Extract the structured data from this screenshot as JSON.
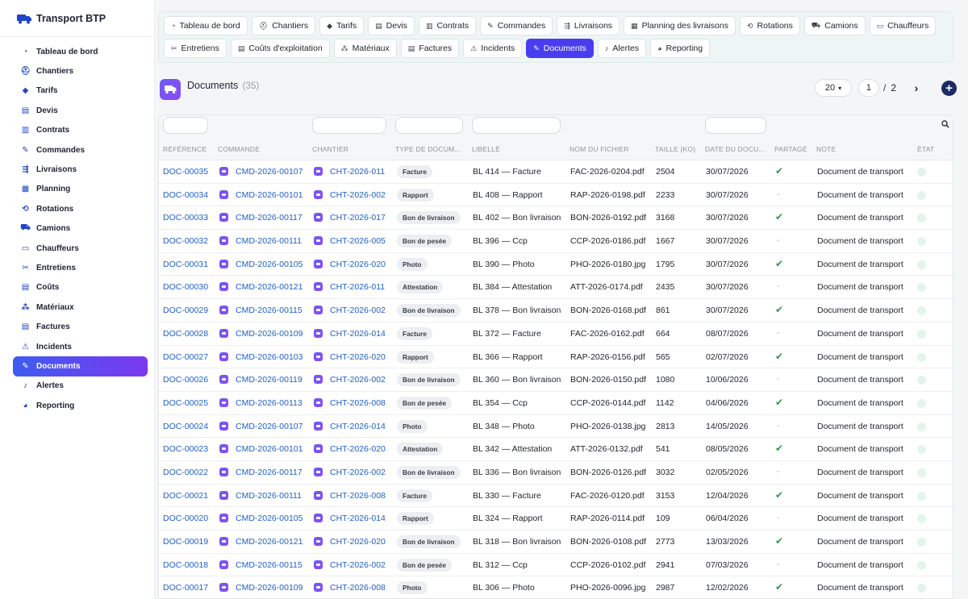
{
  "app": {
    "title": "Transport BTP"
  },
  "sidebar": {
    "items": [
      {
        "label": "Tableau de bord",
        "icon": "dashboard-icon"
      },
      {
        "label": "Chantiers",
        "icon": "helmet-icon"
      },
      {
        "label": "Tarifs",
        "icon": "tag-icon"
      },
      {
        "label": "Devis",
        "icon": "document-icon"
      },
      {
        "label": "Contrats",
        "icon": "contract-icon"
      },
      {
        "label": "Commandes",
        "icon": "order-icon"
      },
      {
        "label": "Livraisons",
        "icon": "delivery-icon"
      },
      {
        "label": "Planning",
        "icon": "calendar-icon"
      },
      {
        "label": "Rotations",
        "icon": "route-icon"
      },
      {
        "label": "Camions",
        "icon": "truck-icon"
      },
      {
        "label": "Chauffeurs",
        "icon": "id-card-icon"
      },
      {
        "label": "Entretiens",
        "icon": "tools-icon"
      },
      {
        "label": "Coûts",
        "icon": "coins-icon"
      },
      {
        "label": "Matériaux",
        "icon": "materials-icon"
      },
      {
        "label": "Factures",
        "icon": "invoice-icon"
      },
      {
        "label": "Incidents",
        "icon": "warning-icon"
      },
      {
        "label": "Documents",
        "icon": "paperclip-icon",
        "active": true
      },
      {
        "label": "Alertes",
        "icon": "bell-icon"
      },
      {
        "label": "Reporting",
        "icon": "pie-chart-icon"
      }
    ]
  },
  "tabs": {
    "row1": [
      {
        "label": "Tableau de bord",
        "icon": "dashboard-icon",
        "glyph": "◔"
      },
      {
        "label": "Chantiers",
        "icon": "helmet-icon",
        "glyph": "⛑"
      },
      {
        "label": "Tarifs",
        "icon": "tag-icon",
        "glyph": "◆"
      },
      {
        "label": "Devis",
        "icon": "document-icon",
        "glyph": "▤"
      },
      {
        "label": "Contrats",
        "icon": "contract-icon",
        "glyph": "▥"
      },
      {
        "label": "Commandes",
        "icon": "order-icon",
        "glyph": "✎"
      },
      {
        "label": "Livraisons",
        "icon": "delivery-icon",
        "glyph": "⇶"
      },
      {
        "label": "Planning des livraisons",
        "icon": "calendar-icon",
        "glyph": "▦"
      },
      {
        "label": "Rotations",
        "icon": "route-icon",
        "glyph": "⟲"
      },
      {
        "label": "Camions",
        "icon": "truck-icon",
        "glyph": "⛟"
      },
      {
        "label": "Chauffeurs",
        "icon": "id-card-icon",
        "glyph": "▭"
      }
    ],
    "row2": [
      {
        "label": "Entretiens",
        "icon": "tools-icon",
        "glyph": "✂"
      },
      {
        "label": "Coûts d'exploitation",
        "icon": "coins-icon",
        "glyph": "▤"
      },
      {
        "label": "Matériaux",
        "icon": "materials-icon",
        "glyph": "⁂"
      },
      {
        "label": "Factures",
        "icon": "invoice-icon",
        "glyph": "▤"
      },
      {
        "label": "Incidents",
        "icon": "warning-icon",
        "glyph": "⚠"
      },
      {
        "label": "Documents",
        "icon": "paperclip-icon",
        "glyph": "✎",
        "active": true
      },
      {
        "label": "Alertes",
        "icon": "bell-icon",
        "glyph": "♪"
      },
      {
        "label": "Reporting",
        "icon": "pie-chart-icon",
        "glyph": "◕"
      }
    ]
  },
  "page": {
    "title": "Documents",
    "count": "(35)"
  },
  "pager": {
    "page_size": "20",
    "current_page": "1",
    "separator": "/",
    "total_pages": "2"
  },
  "columns": [
    "Référence",
    "Commande",
    "Chantier",
    "Type de docum...",
    "Libellé",
    "Nom du fichier",
    "Taille (Ko)",
    "Date du docu...",
    "Partagé",
    "Note",
    "État"
  ],
  "rows": [
    {
      "ref": "DOC-00035",
      "cmd": "CMD-2026-00107",
      "cht": "CHT-2026-011",
      "type": "Facture",
      "lib": "BL 414 — Facture",
      "file": "FAC-2026-0204.pdf",
      "size": "2504",
      "date": "30/07/2026",
      "shared": true,
      "note": "Document de transport"
    },
    {
      "ref": "DOC-00034",
      "cmd": "CMD-2026-00101",
      "cht": "CHT-2026-002",
      "type": "Rapport",
      "lib": "BL 408 — Rapport",
      "file": "RAP-2026-0198.pdf",
      "size": "2233",
      "date": "30/07/2026",
      "shared": false,
      "note": "Document de transport"
    },
    {
      "ref": "DOC-00033",
      "cmd": "CMD-2026-00117",
      "cht": "CHT-2026-017",
      "type": "Bon de livraison",
      "lib": "BL 402 — Bon livraison",
      "file": "BON-2026-0192.pdf",
      "size": "3168",
      "date": "30/07/2026",
      "shared": true,
      "note": "Document de transport"
    },
    {
      "ref": "DOC-00032",
      "cmd": "CMD-2026-00111",
      "cht": "CHT-2026-005",
      "type": "Bon de pesée",
      "lib": "BL 396 — Ccp",
      "file": "CCP-2026-0186.pdf",
      "size": "1667",
      "date": "30/07/2026",
      "shared": false,
      "note": "Document de transport"
    },
    {
      "ref": "DOC-00031",
      "cmd": "CMD-2026-00105",
      "cht": "CHT-2026-020",
      "type": "Photo",
      "lib": "BL 390 — Photo",
      "file": "PHO-2026-0180.jpg",
      "size": "1795",
      "date": "30/07/2026",
      "shared": true,
      "note": "Document de transport"
    },
    {
      "ref": "DOC-00030",
      "cmd": "CMD-2026-00121",
      "cht": "CHT-2026-011",
      "type": "Attestation",
      "lib": "BL 384 — Attestation",
      "file": "ATT-2026-0174.pdf",
      "size": "2435",
      "date": "30/07/2026",
      "shared": false,
      "note": "Document de transport"
    },
    {
      "ref": "DOC-00029",
      "cmd": "CMD-2026-00115",
      "cht": "CHT-2026-002",
      "type": "Bon de livraison",
      "lib": "BL 378 — Bon livraison",
      "file": "BON-2026-0168.pdf",
      "size": "861",
      "date": "30/07/2026",
      "shared": true,
      "note": "Document de transport"
    },
    {
      "ref": "DOC-00028",
      "cmd": "CMD-2026-00109",
      "cht": "CHT-2026-014",
      "type": "Facture",
      "lib": "BL 372 — Facture",
      "file": "FAC-2026-0162.pdf",
      "size": "664",
      "date": "08/07/2026",
      "shared": false,
      "note": "Document de transport"
    },
    {
      "ref": "DOC-00027",
      "cmd": "CMD-2026-00103",
      "cht": "CHT-2026-020",
      "type": "Rapport",
      "lib": "BL 366 — Rapport",
      "file": "RAP-2026-0156.pdf",
      "size": "565",
      "date": "02/07/2026",
      "shared": true,
      "note": "Document de transport"
    },
    {
      "ref": "DOC-00026",
      "cmd": "CMD-2026-00119",
      "cht": "CHT-2026-002",
      "type": "Bon de livraison",
      "lib": "BL 360 — Bon livraison",
      "file": "BON-2026-0150.pdf",
      "size": "1080",
      "date": "10/06/2026",
      "shared": false,
      "note": "Document de transport"
    },
    {
      "ref": "DOC-00025",
      "cmd": "CMD-2026-00113",
      "cht": "CHT-2026-008",
      "type": "Bon de pesée",
      "lib": "BL 354 — Ccp",
      "file": "CCP-2026-0144.pdf",
      "size": "1142",
      "date": "04/06/2026",
      "shared": true,
      "note": "Document de transport"
    },
    {
      "ref": "DOC-00024",
      "cmd": "CMD-2026-00107",
      "cht": "CHT-2026-014",
      "type": "Photo",
      "lib": "BL 348 — Photo",
      "file": "PHO-2026-0138.jpg",
      "size": "2813",
      "date": "14/05/2026",
      "shared": false,
      "note": "Document de transport"
    },
    {
      "ref": "DOC-00023",
      "cmd": "CMD-2026-00101",
      "cht": "CHT-2026-020",
      "type": "Attestation",
      "lib": "BL 342 — Attestation",
      "file": "ATT-2026-0132.pdf",
      "size": "541",
      "date": "08/05/2026",
      "shared": true,
      "note": "Document de transport"
    },
    {
      "ref": "DOC-00022",
      "cmd": "CMD-2026-00117",
      "cht": "CHT-2026-002",
      "type": "Bon de livraison",
      "lib": "BL 336 — Bon livraison",
      "file": "BON-2026-0126.pdf",
      "size": "3032",
      "date": "02/05/2026",
      "shared": false,
      "note": "Document de transport"
    },
    {
      "ref": "DOC-00021",
      "cmd": "CMD-2026-00111",
      "cht": "CHT-2026-008",
      "type": "Facture",
      "lib": "BL 330 — Facture",
      "file": "FAC-2026-0120.pdf",
      "size": "3153",
      "date": "12/04/2026",
      "shared": true,
      "note": "Document de transport"
    },
    {
      "ref": "DOC-00020",
      "cmd": "CMD-2026-00105",
      "cht": "CHT-2026-014",
      "type": "Rapport",
      "lib": "BL 324 — Rapport",
      "file": "RAP-2026-0114.pdf",
      "size": "109",
      "date": "06/04/2026",
      "shared": false,
      "note": "Document de transport"
    },
    {
      "ref": "DOC-00019",
      "cmd": "CMD-2026-00121",
      "cht": "CHT-2026-020",
      "type": "Bon de livraison",
      "lib": "BL 318 — Bon livraison",
      "file": "BON-2026-0108.pdf",
      "size": "2773",
      "date": "13/03/2026",
      "shared": true,
      "note": "Document de transport"
    },
    {
      "ref": "DOC-00018",
      "cmd": "CMD-2026-00115",
      "cht": "CHT-2026-002",
      "type": "Bon de pesée",
      "lib": "BL 312 — Ccp",
      "file": "CCP-2026-0102.pdf",
      "size": "2941",
      "date": "07/03/2026",
      "shared": false,
      "note": "Document de transport"
    },
    {
      "ref": "DOC-00017",
      "cmd": "CMD-2026-00109",
      "cht": "CHT-2026-008",
      "type": "Photo",
      "lib": "BL 306 — Photo",
      "file": "PHO-2026-0096.jpg",
      "size": "2987",
      "date": "12/02/2026",
      "shared": true,
      "note": "Document de transport"
    }
  ],
  "shared_yes": "✔",
  "shared_no": "-",
  "colors": {
    "accent": "#4a3df0",
    "link": "#2060c8",
    "check": "#2a9a46",
    "nav_icon": "#1f45c8"
  }
}
